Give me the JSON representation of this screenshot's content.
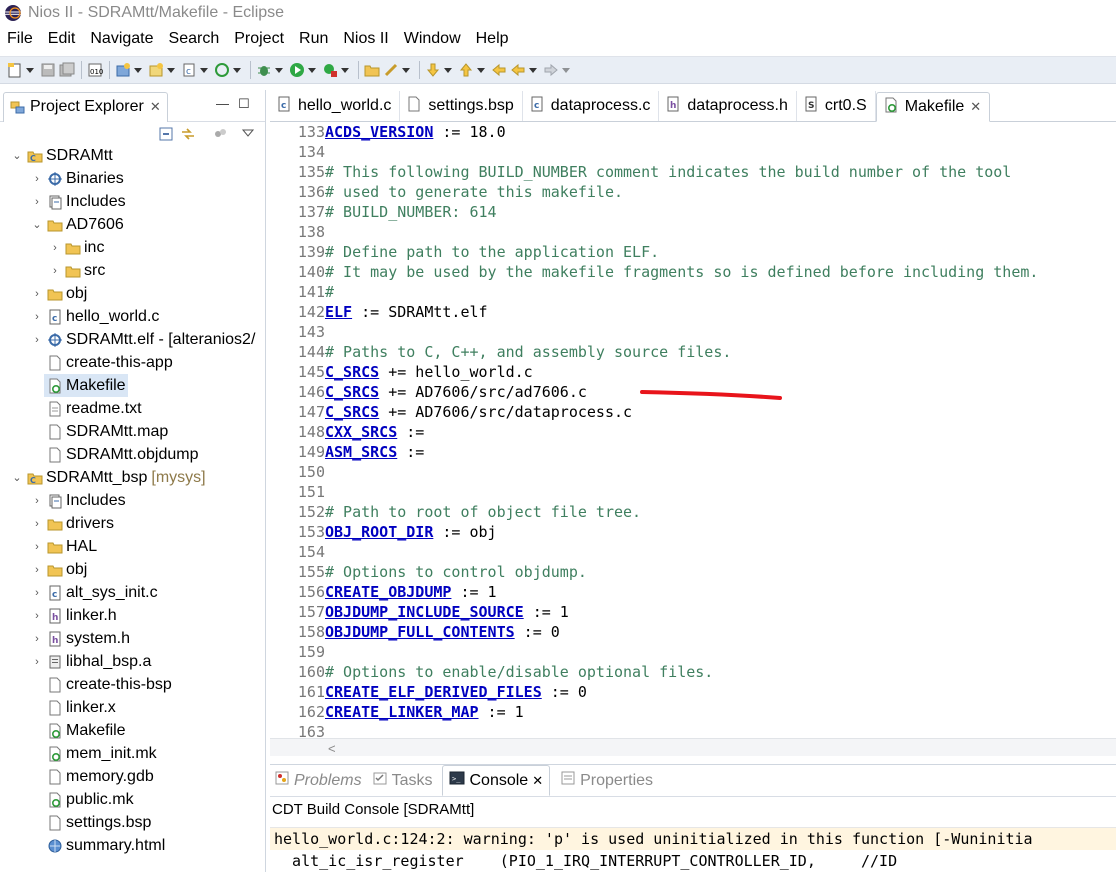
{
  "window": {
    "title": "Nios II - SDRAMtt/Makefile - Eclipse"
  },
  "menubar": {
    "items": [
      "File",
      "Edit",
      "Navigate",
      "Search",
      "Project",
      "Run",
      "Nios II",
      "Window",
      "Help"
    ]
  },
  "project_explorer": {
    "tab_label": "Project Explorer",
    "tree": [
      {
        "label": "SDRAMtt",
        "icon": "project-icon",
        "arrow": "expanded",
        "depth": 0
      },
      {
        "label": "Binaries",
        "icon": "binaries-icon",
        "arrow": "collapsed",
        "depth": 1
      },
      {
        "label": "Includes",
        "icon": "includes-icon",
        "arrow": "collapsed",
        "depth": 1
      },
      {
        "label": "AD7606",
        "icon": "folder-icon",
        "arrow": "expanded",
        "depth": 1
      },
      {
        "label": "inc",
        "icon": "folder-icon",
        "arrow": "collapsed",
        "depth": 2
      },
      {
        "label": "src",
        "icon": "folder-icon",
        "arrow": "collapsed",
        "depth": 2
      },
      {
        "label": "obj",
        "icon": "folder-icon",
        "arrow": "collapsed",
        "depth": 1
      },
      {
        "label": "hello_world.c",
        "icon": "c-file-icon",
        "arrow": "collapsed",
        "depth": 1
      },
      {
        "label": "SDRAMtt.elf - [alteranios2/",
        "icon": "elf-icon",
        "arrow": "collapsed",
        "depth": 1
      },
      {
        "label": "create-this-app",
        "icon": "file-icon",
        "arrow": "none",
        "depth": 1
      },
      {
        "label": "Makefile",
        "icon": "makefile-icon",
        "arrow": "none",
        "depth": 1,
        "selected": true
      },
      {
        "label": "readme.txt",
        "icon": "text-file-icon",
        "arrow": "none",
        "depth": 1
      },
      {
        "label": "SDRAMtt.map",
        "icon": "file-icon",
        "arrow": "none",
        "depth": 1
      },
      {
        "label": "SDRAMtt.objdump",
        "icon": "file-icon",
        "arrow": "none",
        "depth": 1
      },
      {
        "label": "SDRAMtt_bsp",
        "suffix": "[mysys]",
        "icon": "project-icon",
        "arrow": "expanded",
        "depth": 0
      },
      {
        "label": "Includes",
        "icon": "includes-icon",
        "arrow": "collapsed",
        "depth": 1
      },
      {
        "label": "drivers",
        "icon": "folder-icon",
        "arrow": "collapsed",
        "depth": 1
      },
      {
        "label": "HAL",
        "icon": "folder-icon",
        "arrow": "collapsed",
        "depth": 1
      },
      {
        "label": "obj",
        "icon": "folder-icon",
        "arrow": "collapsed",
        "depth": 1
      },
      {
        "label": "alt_sys_init.c",
        "icon": "c-file-icon",
        "arrow": "collapsed",
        "depth": 1
      },
      {
        "label": "linker.h",
        "icon": "h-file-icon",
        "arrow": "collapsed",
        "depth": 1
      },
      {
        "label": "system.h",
        "icon": "h-file-icon",
        "arrow": "collapsed",
        "depth": 1
      },
      {
        "label": "libhal_bsp.a",
        "icon": "archive-icon",
        "arrow": "collapsed",
        "depth": 1
      },
      {
        "label": "create-this-bsp",
        "icon": "file-icon",
        "arrow": "none",
        "depth": 1
      },
      {
        "label": "linker.x",
        "icon": "file-icon",
        "arrow": "none",
        "depth": 1
      },
      {
        "label": "Makefile",
        "icon": "makefile-icon",
        "arrow": "none",
        "depth": 1
      },
      {
        "label": "mem_init.mk",
        "icon": "makefile-icon",
        "arrow": "none",
        "depth": 1
      },
      {
        "label": "memory.gdb",
        "icon": "file-icon",
        "arrow": "none",
        "depth": 1
      },
      {
        "label": "public.mk",
        "icon": "makefile-icon",
        "arrow": "none",
        "depth": 1
      },
      {
        "label": "settings.bsp",
        "icon": "file-icon",
        "arrow": "none",
        "depth": 1
      },
      {
        "label": "summary.html",
        "icon": "html-file-icon",
        "arrow": "none",
        "depth": 1
      }
    ]
  },
  "editor": {
    "tabs": [
      {
        "label": "hello_world.c",
        "icon": "c-file-icon"
      },
      {
        "label": "settings.bsp",
        "icon": "file-icon"
      },
      {
        "label": "dataprocess.c",
        "icon": "c-file-icon"
      },
      {
        "label": "dataprocess.h",
        "icon": "h-file-icon"
      },
      {
        "label": "crt0.S",
        "icon": "s-file-icon"
      },
      {
        "label": "Makefile",
        "icon": "makefile-icon",
        "active": true
      }
    ],
    "lines": [
      {
        "n": "133",
        "var": "ACDS_VERSION",
        "rest": " := 18.0"
      },
      {
        "n": "134",
        "text": ""
      },
      {
        "n": "135",
        "comment": "# This following BUILD_NUMBER comment indicates the build number of the tool"
      },
      {
        "n": "136",
        "comment": "# used to generate this makefile."
      },
      {
        "n": "137",
        "comment": "# BUILD_NUMBER: 614"
      },
      {
        "n": "138",
        "text": ""
      },
      {
        "n": "139",
        "comment": "# Define path to the application ELF."
      },
      {
        "n": "140",
        "comment": "# It may be used by the makefile fragments so is defined before including them."
      },
      {
        "n": "141",
        "comment": "#"
      },
      {
        "n": "142",
        "var": "ELF",
        "rest": " := SDRAMtt.elf"
      },
      {
        "n": "143",
        "text": ""
      },
      {
        "n": "144",
        "comment": "# Paths to C, C++, and assembly source files."
      },
      {
        "n": "145",
        "var": "C_SRCS",
        "rest": " += hello_world.c"
      },
      {
        "n": "146",
        "var": "C_SRCS",
        "rest": " += AD7606/src/ad7606.c"
      },
      {
        "n": "147",
        "var": "C_SRCS",
        "rest": " += AD7606/src/dataprocess.c"
      },
      {
        "n": "148",
        "var": "CXX_SRCS",
        "rest": " :="
      },
      {
        "n": "149",
        "var": "ASM_SRCS",
        "rest": " :="
      },
      {
        "n": "150",
        "text": ""
      },
      {
        "n": "151",
        "text": ""
      },
      {
        "n": "152",
        "comment": "# Path to root of object file tree."
      },
      {
        "n": "153",
        "var": "OBJ_ROOT_DIR",
        "rest": " := obj"
      },
      {
        "n": "154",
        "text": ""
      },
      {
        "n": "155",
        "comment": "# Options to control objdump."
      },
      {
        "n": "156",
        "var": "CREATE_OBJDUMP",
        "rest": " := 1"
      },
      {
        "n": "157",
        "var": "OBJDUMP_INCLUDE_SOURCE",
        "rest": " := 1"
      },
      {
        "n": "158",
        "var": "OBJDUMP_FULL_CONTENTS",
        "rest": " := 0"
      },
      {
        "n": "159",
        "text": ""
      },
      {
        "n": "160",
        "comment": "# Options to enable/disable optional files."
      },
      {
        "n": "161",
        "var": "CREATE_ELF_DERIVED_FILES",
        "rest": " := 0"
      },
      {
        "n": "162",
        "var": "CREATE_LINKER_MAP",
        "rest": " := 1"
      },
      {
        "n": "163",
        "text": ""
      }
    ]
  },
  "bottom": {
    "tabs": [
      {
        "label": "Problems",
        "icon": "problems-icon",
        "italic": true
      },
      {
        "label": "Tasks",
        "icon": "tasks-icon"
      },
      {
        "label": "Console",
        "icon": "console-icon",
        "active": true
      },
      {
        "label": "Properties",
        "icon": "properties-icon"
      }
    ],
    "console_title": "CDT Build Console [SDRAMtt]",
    "console_lines": [
      "hello_world.c:124:2: warning: 'p' is used uninitialized in this function [-Wuninitia",
      "  alt_ic_isr_register    (PIO_1_IRQ_INTERRUPT_CONTROLLER_ID,     //ID"
    ]
  },
  "colors": {
    "keyword_var": "#0000c0",
    "comment": "#3f7f5f",
    "annotation": "#e8141b",
    "selection": "#d9e6f5",
    "toolbar_bg": "#e9eef5"
  }
}
